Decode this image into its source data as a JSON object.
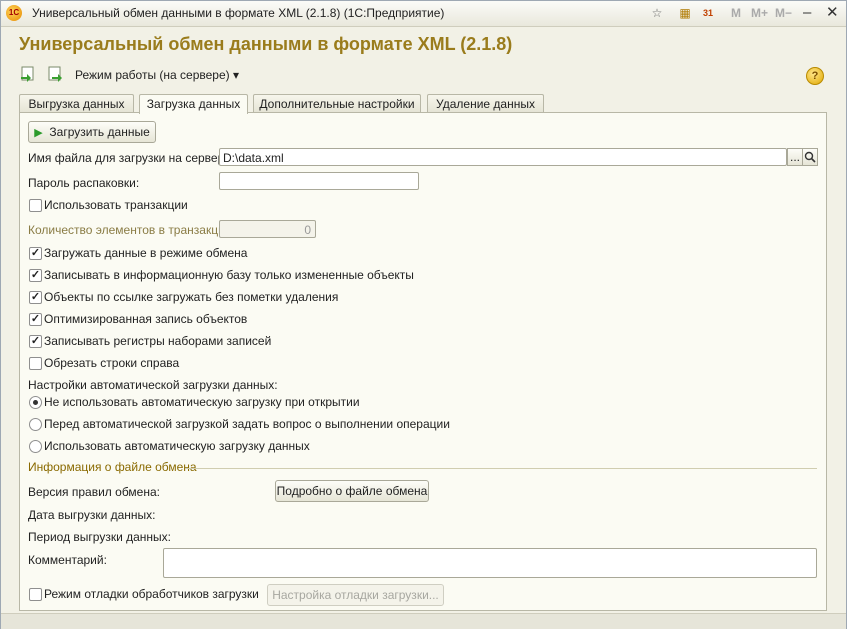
{
  "window": {
    "title": "Универсальный обмен данными в формате XML (2.1.8)  (1С:Предприятие)",
    "app_icon_text": "1С",
    "memory_buttons": [
      "M",
      "M+",
      "M−"
    ],
    "calendar_day": "31"
  },
  "header": {
    "title": "Универсальный обмен данными в формате XML (2.1.8)"
  },
  "toolbar": {
    "mode_label": "Режим работы (на сервере)",
    "mode_arrow": "▾",
    "help_label": "?"
  },
  "tabs": [
    {
      "label": "Выгрузка данных"
    },
    {
      "label": "Загрузка данных"
    },
    {
      "label": "Дополнительные настройки"
    },
    {
      "label": "Удаление данных"
    }
  ],
  "load": {
    "load_button": "Загрузить данные",
    "file_label": "Имя файла для загрузки на сервере:",
    "file_value": "D:\\data.xml",
    "browse_label": "...",
    "password_label": "Пароль распаковки:",
    "password_value": "",
    "use_transactions": "Использовать транзакции",
    "items_in_tx_label": "Количество элементов в транзакции:",
    "items_in_tx_value": "0",
    "options": [
      {
        "label": "Загружать данные в режиме обмена",
        "checked": true
      },
      {
        "label": "Записывать в информационную базу только измененные объекты",
        "checked": true
      },
      {
        "label": "Объекты по ссылке загружать без пометки удаления",
        "checked": true
      },
      {
        "label": "Оптимизированная запись объектов",
        "checked": true
      },
      {
        "label": "Записывать регистры наборами записей",
        "checked": true
      },
      {
        "label": "Обрезать строки справа",
        "checked": false
      }
    ],
    "auto_title": "Настройки автоматической загрузки данных:",
    "auto_options": [
      {
        "label": "Не использовать автоматическую загрузку при открытии",
        "selected": true
      },
      {
        "label": "Перед автоматической загрузкой задать вопрос о выполнении операции",
        "selected": false
      },
      {
        "label": "Использовать автоматическую загрузку данных",
        "selected": false
      }
    ],
    "info_group": "Информация о файле обмена",
    "rules_version_label": "Версия правил обмена:",
    "details_button": "Подробно о файле обмена",
    "export_date_label": "Дата выгрузки данных:",
    "export_period_label": "Период выгрузки данных:",
    "comment_label": "Комментарий:",
    "comment_value": "",
    "debug_label": "Режим отладки обработчиков загрузки",
    "debug_button": "Настройка отладки загрузки..."
  }
}
